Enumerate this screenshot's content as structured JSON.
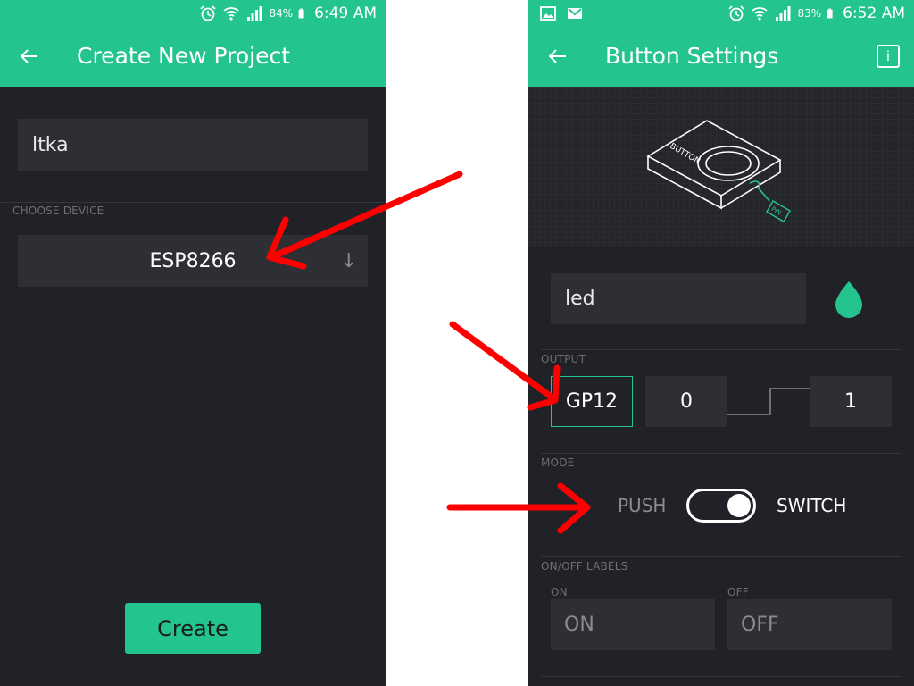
{
  "left": {
    "status": {
      "battery_pct": "84%",
      "time": "6:49 AM"
    },
    "title": "Create New Project",
    "project_name": "ltka",
    "choose_device_label": "CHOOSE DEVICE",
    "device": "ESP8266",
    "create_label": "Create"
  },
  "right": {
    "status": {
      "battery_pct": "83%",
      "time": "6:52 AM"
    },
    "title": "Button Settings",
    "info_label": "i",
    "widget_image": {
      "button_text": "BUTTON",
      "pin_text": "PIN"
    },
    "widget_name": "led",
    "output_label": "OUTPUT",
    "output": {
      "pin": "GP12",
      "low": "0",
      "high": "1"
    },
    "mode_label": "MODE",
    "mode": {
      "push_label": "PUSH",
      "switch_label": "SWITCH",
      "selected": "SWITCH"
    },
    "onoff_label": "ON/OFF LABELS",
    "on_caption": "ON",
    "off_caption": "OFF",
    "on_placeholder": "ON",
    "off_placeholder": "OFF"
  },
  "colors": {
    "accent": "#23c48e",
    "background": "#212227",
    "field": "#2e2f34",
    "annotation_arrow": "#ff0000"
  }
}
